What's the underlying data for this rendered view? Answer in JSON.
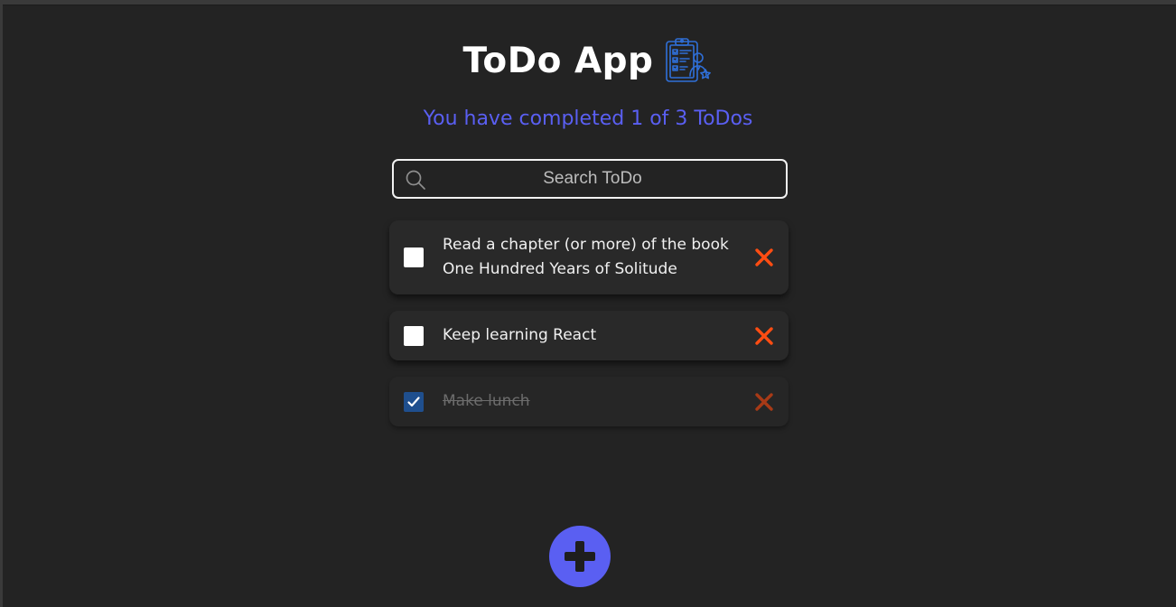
{
  "header": {
    "title": "ToDo App",
    "icon": "clipboard-checklist-icon"
  },
  "counter": {
    "text": "You have completed 1 of 3 ToDos",
    "completed": 1,
    "total": 3
  },
  "search": {
    "placeholder": "Search ToDo",
    "value": "",
    "icon": "search-icon"
  },
  "todos": [
    {
      "text": "Read a chapter (or more) of the book One Hundred Years of Solitude",
      "completed": false
    },
    {
      "text": "Keep learning React",
      "completed": false
    },
    {
      "text": "Make lunch",
      "completed": true
    }
  ],
  "add_button": {
    "icon": "plus-icon"
  },
  "colors": {
    "background": "#232323",
    "accent": "#5a5ff2",
    "delete": "#ff4d12",
    "card": "#292929",
    "checked": "#1f4f8e"
  }
}
